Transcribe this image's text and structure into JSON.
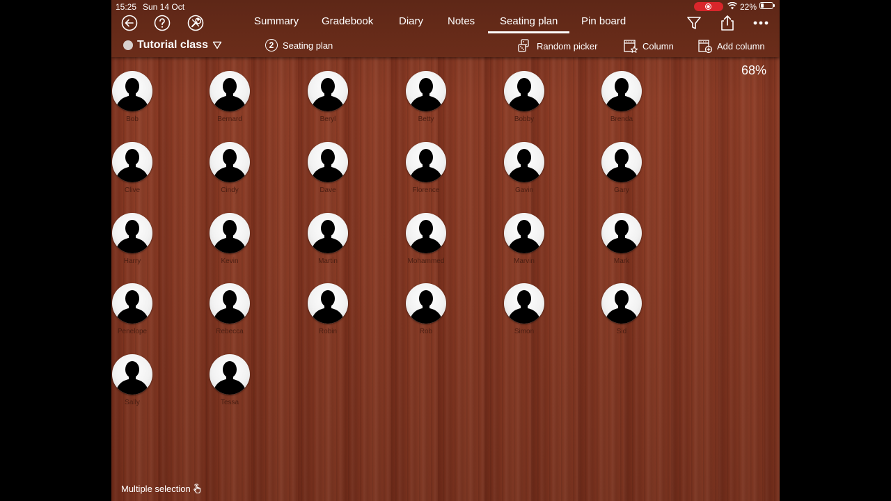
{
  "status_bar": {
    "time": "15:25",
    "date": "Sun 14 Oct",
    "battery": "22%"
  },
  "tabs": [
    {
      "label": "Summary"
    },
    {
      "label": "Gradebook"
    },
    {
      "label": "Diary"
    },
    {
      "label": "Notes"
    },
    {
      "label": "Seating plan",
      "active": true
    },
    {
      "label": "Pin board"
    }
  ],
  "class_selector": {
    "name": "Tutorial class"
  },
  "seating_plan": {
    "number": "2",
    "label": "Seating plan"
  },
  "toolbar": {
    "random_picker": "Random picker",
    "column": "Column",
    "add_column": "Add column"
  },
  "zoom": "68%",
  "students": [
    [
      "Bob",
      "Bernard",
      "Beryl",
      "Betty",
      "Bobby",
      "Brenda"
    ],
    [
      "Clive",
      "Cindy",
      "Dave",
      "Florence",
      "Gavin",
      "Gary"
    ],
    [
      "Harry",
      "Kevin",
      "Martin",
      "Mohammed",
      "Marvin",
      "Mark"
    ],
    [
      "Penelope",
      "Rebecca",
      "Robin",
      "Rob",
      "Simon",
      "Sid"
    ],
    [
      "Sally",
      "Tessa"
    ]
  ],
  "footer": {
    "multiple_selection": "Multiple selection"
  },
  "colors": {
    "wood": "#843722",
    "topbar": "#6b2d1a",
    "record": "#d9262b",
    "name_text": "#4a1e12"
  }
}
